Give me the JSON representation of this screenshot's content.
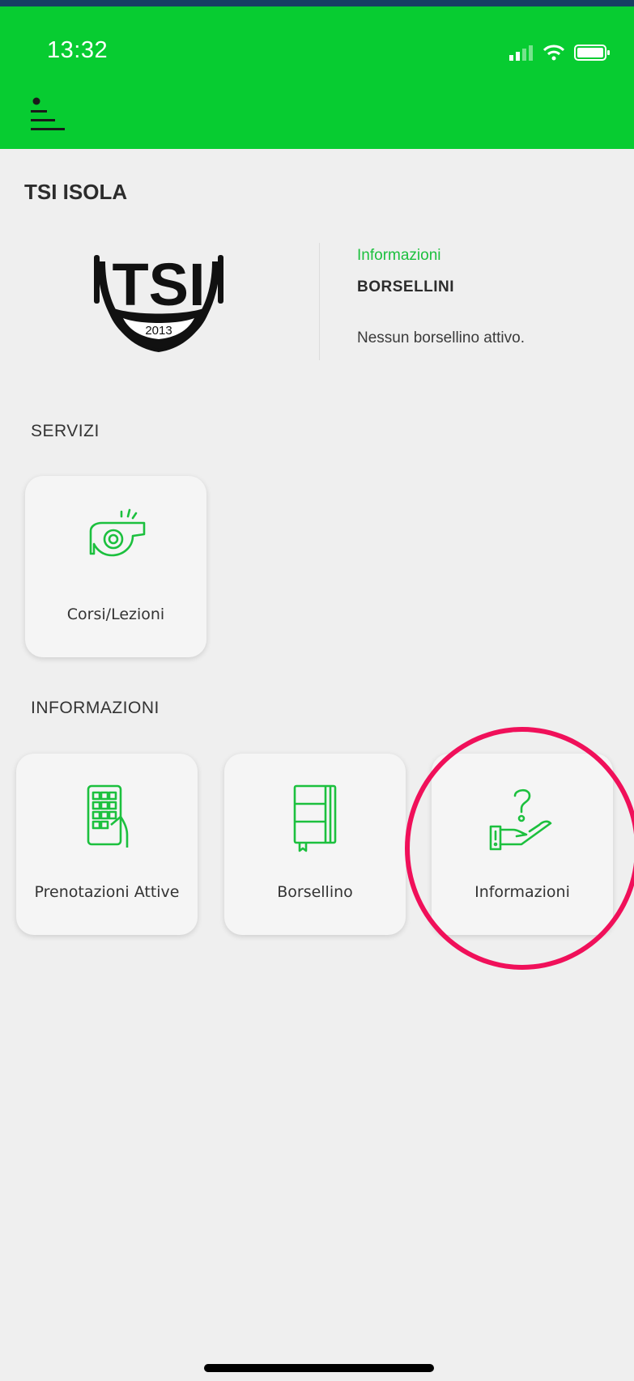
{
  "status_bar": {
    "time": "13:32"
  },
  "club": {
    "name": "TSI ISOLA"
  },
  "logo": {
    "text": "TSI",
    "year": "2013"
  },
  "info_panel": {
    "label": "Informazioni",
    "title": "BORSELLINI",
    "message": "Nessun borsellino attivo."
  },
  "sections": {
    "servizi": {
      "title": "SERVIZI",
      "tiles": [
        {
          "label": "Corsi/Lezioni",
          "icon": "whistle-icon"
        }
      ]
    },
    "informazioni": {
      "title": "INFORMAZIONI",
      "tiles": [
        {
          "label": "Prenotazioni Attive",
          "icon": "phone-keypad-icon"
        },
        {
          "label": "Borsellino",
          "icon": "notebook-icon"
        },
        {
          "label": "Informazioni",
          "icon": "help-hand-icon"
        }
      ]
    }
  },
  "colors": {
    "header_bg": "#07cc31",
    "accent_green": "#1cc03e",
    "highlight_circle": "#f0105a",
    "background": "#efefef"
  }
}
